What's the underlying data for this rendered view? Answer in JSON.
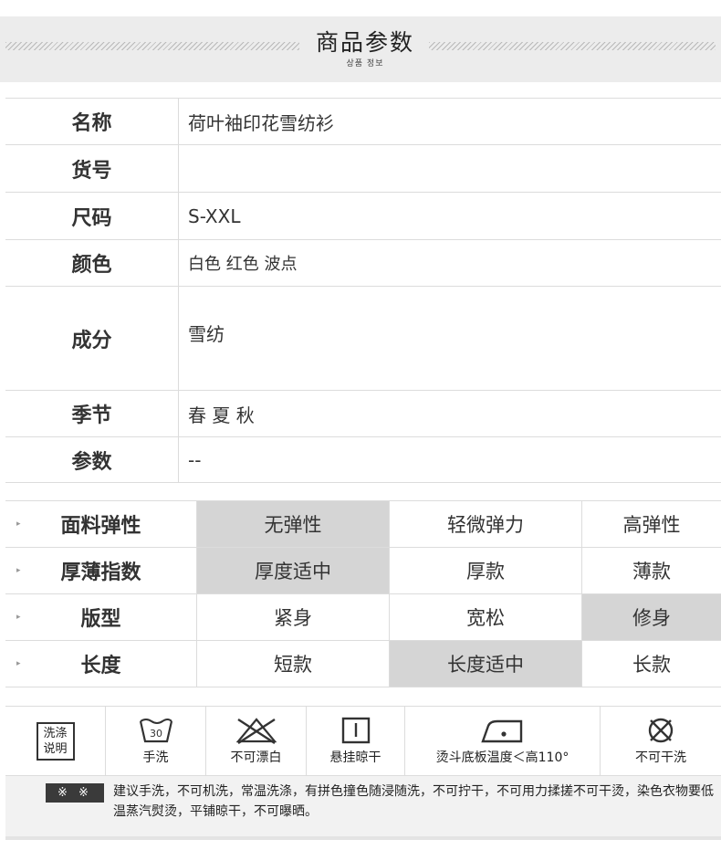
{
  "header": {
    "title": "商品参数",
    "subtitle": "상품 정보"
  },
  "info": [
    {
      "label": "名称",
      "value": "荷叶袖印花雪纺衫"
    },
    {
      "label": "货号",
      "value": ""
    },
    {
      "label": "尺码",
      "value": "S-XXL"
    },
    {
      "label": "颜色",
      "value": "白色 红色 波点"
    },
    {
      "label": "成分",
      "value": "雪纺"
    },
    {
      "label": "季节",
      "value": "春 夏 秋"
    },
    {
      "label": "参数",
      "value": "--"
    }
  ],
  "attributes": [
    {
      "label": "面料弹性",
      "options": [
        "无弹性",
        "轻微弹力",
        "高弹性"
      ],
      "selected": "无弹性"
    },
    {
      "label": "厚薄指数",
      "options": [
        "厚度适中",
        "厚款",
        "薄款"
      ],
      "selected": "厚度适中"
    },
    {
      "label": "版型",
      "options": [
        "紧身",
        "宽松",
        "修身"
      ],
      "selected": "修身"
    },
    {
      "label": "长度",
      "options": [
        "短款",
        "长度适中",
        "长款"
      ],
      "selected": "长度适中"
    }
  ],
  "arrow_glyph": "▸",
  "care": {
    "heading": "洗涤说明",
    "icons": [
      {
        "icon": "hand-wash-30-icon",
        "label": "手洗",
        "temp": "30"
      },
      {
        "icon": "no-bleach-icon",
        "label": "不可漂白"
      },
      {
        "icon": "hang-dry-icon",
        "label": "悬挂晾干"
      },
      {
        "icon": "iron-low-icon",
        "label": "烫斗底板温度＜高110°"
      },
      {
        "icon": "no-dry-clean-icon",
        "label": "不可干洗"
      }
    ],
    "badge": "※ ※",
    "note": "建议手洗，不可机洗，常温洗涤，有拼色撞色随浸随洗，不可拧干，不可用力揉搓不可干烫，染色衣物要低温蒸汽熨烫，平铺晾干，不可曝晒。"
  },
  "colors": {
    "selected_bg": "#d5d5d5",
    "border": "#dcdcdc",
    "header_bg": "#ececec",
    "badge_bg": "#3a3a3a"
  }
}
